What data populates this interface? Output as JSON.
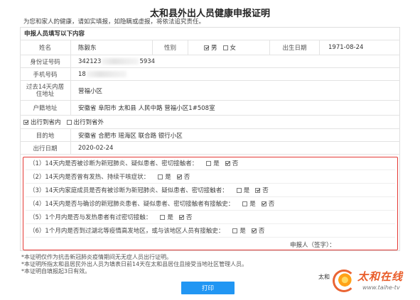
{
  "title": "太和县外出人员健康申报证明",
  "notice": "为您和家人的健康，请如实填报，如隐瞒或虚报，将依法追究责任。",
  "section_header": "申报人员填写以下内容",
  "form": {
    "name": {
      "label": "姓名",
      "value": "陈毅东"
    },
    "gender": {
      "label": "性别",
      "male": {
        "label": "男",
        "checked": true
      },
      "female": {
        "label": "女",
        "checked": false
      }
    },
    "birth": {
      "label": "出生日期",
      "value": "1971-08-24"
    },
    "id_card": {
      "label": "身份证号码",
      "value_prefix": "342123",
      "value_suffix": "5934"
    },
    "phone": {
      "label": "手机号码",
      "value_prefix": "18"
    },
    "residence": {
      "label": "过去14天内居住地址",
      "value": "营福小区"
    },
    "household": {
      "label": "户籍地址",
      "value": "安徽省 阜阳市 太和县 人民中路 营福小区1#508室"
    },
    "travel": {
      "in_province": {
        "label": "出行到省内",
        "checked": true
      },
      "out_province": {
        "label": "出行到省外",
        "checked": false
      }
    },
    "destination": {
      "label": "目的地",
      "value": "安徽省 合肥市 瑶海区 联合路 银行小区"
    },
    "travel_date": {
      "label": "出行日期",
      "value": "2020-02-24"
    }
  },
  "questions": [
    {
      "text": "（1）14天内是否被诊断为新冠肺炎、疑似患者、密切接触者：",
      "options": [
        {
          "label": "是",
          "checked": false
        },
        {
          "label": "否",
          "checked": true
        }
      ]
    },
    {
      "text": "（2）14天内是否曾有发热、持续干咳症状：",
      "options": [
        {
          "label": "是",
          "checked": false
        },
        {
          "label": "否",
          "checked": true
        }
      ]
    },
    {
      "text": "（3）14天内家庭成员是否有被诊断为新冠肺炎、疑似患者、密切接触者：",
      "options": [
        {
          "label": "是",
          "checked": false
        },
        {
          "label": "否",
          "checked": true
        }
      ]
    },
    {
      "text": "（4）14天内是否与确诊的新冠肺炎患者、疑似患者、密切接触者有接触史：",
      "options": [
        {
          "label": "是",
          "checked": false
        },
        {
          "label": "否",
          "checked": true
        }
      ]
    },
    {
      "text": "（5）1个月内是否与发热患者有过密切接触：",
      "options": [
        {
          "label": "是",
          "checked": false
        },
        {
          "label": "否",
          "checked": true
        }
      ]
    },
    {
      "text": "（6）1个月内是否到过湖北等疫情高发地区，或与该地区人员有接触史：",
      "options": [
        {
          "label": "是",
          "checked": false
        },
        {
          "label": "否",
          "checked": true
        }
      ]
    }
  ],
  "signature_label": "申报人（签字）：",
  "footnotes": [
    "*本证明仅作为抗击新冠肺炎疫情期间无无症人员出行证明。",
    "*本证明所指太和县居民外出人员为填表日前14天在太和县居住且接受当地社区管理人员。",
    "*本证明自填报起3日有效。"
  ],
  "print_button": "打印",
  "issuer_fragment": "太和",
  "watermark": {
    "brand": "太和在线",
    "url": "www.taihe-tv",
    "icon": "swirl-logo-icon"
  },
  "colors": {
    "highlight_border": "#e53935",
    "print_button": "#2196f3",
    "watermark": "#e8541e"
  }
}
